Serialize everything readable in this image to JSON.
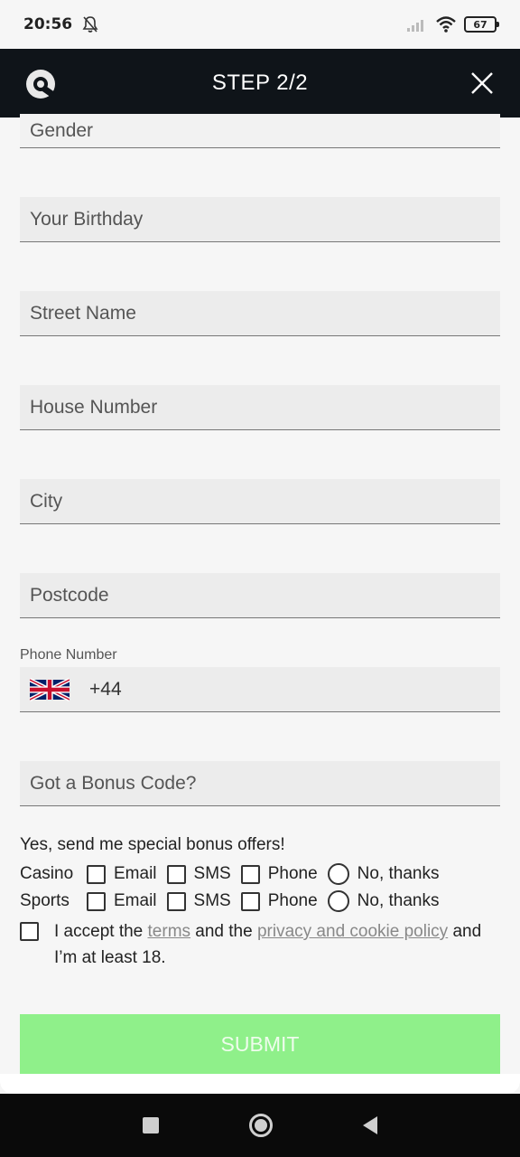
{
  "status_bar": {
    "time": "20:56",
    "battery": "67"
  },
  "header": {
    "title": "STEP 2/2"
  },
  "form": {
    "gender": "Gender",
    "birthday": "Your Birthday",
    "street": "Street Name",
    "house": "House Number",
    "city": "City",
    "postcode": "Postcode",
    "phone_label": "Phone Number",
    "phone_code": "+44",
    "bonus_code": "Got a Bonus Code?"
  },
  "offers": {
    "heading": "Yes, send me special bonus offers!",
    "rows": [
      {
        "label": "Casino",
        "email": "Email",
        "sms": "SMS",
        "phone": "Phone",
        "no": "No, thanks"
      },
      {
        "label": "Sports",
        "email": "Email",
        "sms": "SMS",
        "phone": "Phone",
        "no": "No, thanks"
      }
    ],
    "accept_prefix": "I accept the ",
    "terms": "terms",
    "accept_mid": " and the ",
    "privacy": "privacy and cookie policy",
    "accept_suffix": " and I’m at least 18."
  },
  "submit_label": "SUBMIT",
  "colors": {
    "header_bg": "#0f1419",
    "submit_bg": "#8ff08a"
  }
}
